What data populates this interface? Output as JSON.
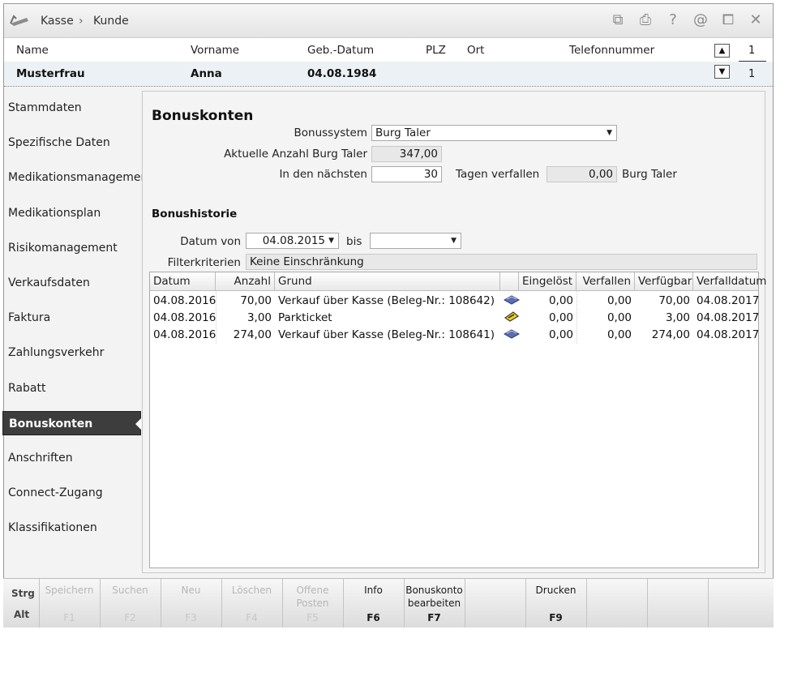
{
  "titlebar": {
    "breadcrumb": [
      "Kasse",
      "›",
      "Kunde"
    ],
    "icons": [
      "copy-icon",
      "print-icon",
      "help-icon",
      "email-icon",
      "window-icon",
      "close-icon"
    ],
    "icon_glyphs": [
      "⧉",
      "⎙",
      "?",
      "@",
      "⧠",
      "✕"
    ]
  },
  "customer": {
    "headers": {
      "name": "Name",
      "vorname": "Vorname",
      "geb": "Geb.-Datum",
      "plz": "PLZ",
      "ort": "Ort",
      "telefon": "Telefonnummer"
    },
    "values": {
      "name": "Musterfrau",
      "vorname": "Anna",
      "geb": "04.08.1984",
      "plz": "",
      "ort": "",
      "telefon": ""
    },
    "page_current": "1",
    "page_total": "1"
  },
  "sidebar": {
    "items": [
      {
        "label": "Stammdaten",
        "active": false
      },
      {
        "label": "Spezifische Daten",
        "active": false
      },
      {
        "label": "Medikationsmanagement",
        "active": false
      },
      {
        "label": "Medikationsplan",
        "active": false
      },
      {
        "label": "Risikomanagement",
        "active": false
      },
      {
        "label": "Verkaufsdaten",
        "active": false
      },
      {
        "label": "Faktura",
        "active": false
      },
      {
        "label": "Zahlungsverkehr",
        "active": false
      },
      {
        "label": "Rabatt",
        "active": false
      },
      {
        "label": "Bonuskonten",
        "active": true
      },
      {
        "label": "Anschriften",
        "active": false
      },
      {
        "label": "Connect-Zugang",
        "active": false
      },
      {
        "label": "Klassifikationen",
        "active": false
      }
    ]
  },
  "main": {
    "title": "Bonuskonten",
    "bonussystem_label": "Bonussystem",
    "bonussystem_value": "Burg Taler",
    "anzahl_label": "Aktuelle Anzahl Burg Taler",
    "anzahl_value": "347,00",
    "naechsten_label": "In den nächsten",
    "naechsten_value": "30",
    "verfallen_label": "Tagen verfallen",
    "verfallen_value": "0,00",
    "verfallen_unit": "Burg Taler",
    "historie_title": "Bonushistorie",
    "datum_von_label": "Datum von",
    "datum_von_value": "04.08.2015",
    "bis_label": "bis",
    "bis_value": "",
    "filter_label": "Filterkriterien",
    "filter_value": "Keine Einschränkung"
  },
  "table": {
    "columns": [
      "Datum",
      "Anzahl",
      "Grund",
      "",
      "Eingelöst",
      "Verfallen",
      "Verfügbar",
      "Verfalldatum"
    ],
    "rows": [
      {
        "datum": "04.08.2016",
        "anzahl": "70,00",
        "grund": "Verkauf über Kasse (Beleg-Nr.: 108642)",
        "icon": "cash-register-icon",
        "eingeloest": "0,00",
        "verfallen": "0,00",
        "verfuegbar": "70,00",
        "verfalldatum": "04.08.2017"
      },
      {
        "datum": "04.08.2016",
        "anzahl": "3,00",
        "grund": "Parkticket",
        "icon": "ticket-icon",
        "eingeloest": "0,00",
        "verfallen": "0,00",
        "verfuegbar": "3,00",
        "verfalldatum": "04.08.2017"
      },
      {
        "datum": "04.08.2016",
        "anzahl": "274,00",
        "grund": "Verkauf über Kasse (Beleg-Nr.: 108641)",
        "icon": "cash-register-icon",
        "eingeloest": "0,00",
        "verfallen": "0,00",
        "verfuegbar": "274,00",
        "verfalldatum": "04.08.2017"
      }
    ]
  },
  "fkeys": {
    "mod1": "Strg",
    "mod2": "Alt",
    "keys": [
      {
        "label": "Speichern",
        "key": "F1",
        "enabled": false
      },
      {
        "label": "Suchen",
        "key": "F2",
        "enabled": false
      },
      {
        "label": "Neu",
        "key": "F3",
        "enabled": false
      },
      {
        "label": "Löschen",
        "key": "F4",
        "enabled": false
      },
      {
        "label": "Offene Posten",
        "key": "F5",
        "enabled": false
      },
      {
        "label": "Info",
        "key": "F6",
        "enabled": true
      },
      {
        "label": "Bonuskonto bearbeiten",
        "key": "F7",
        "enabled": true
      },
      {
        "label": "",
        "key": "",
        "enabled": true
      },
      {
        "label": "Drucken",
        "key": "F9",
        "enabled": true
      },
      {
        "label": "",
        "key": "",
        "enabled": true
      },
      {
        "label": "",
        "key": "",
        "enabled": true
      },
      {
        "label": "",
        "key": "",
        "enabled": true
      }
    ]
  }
}
